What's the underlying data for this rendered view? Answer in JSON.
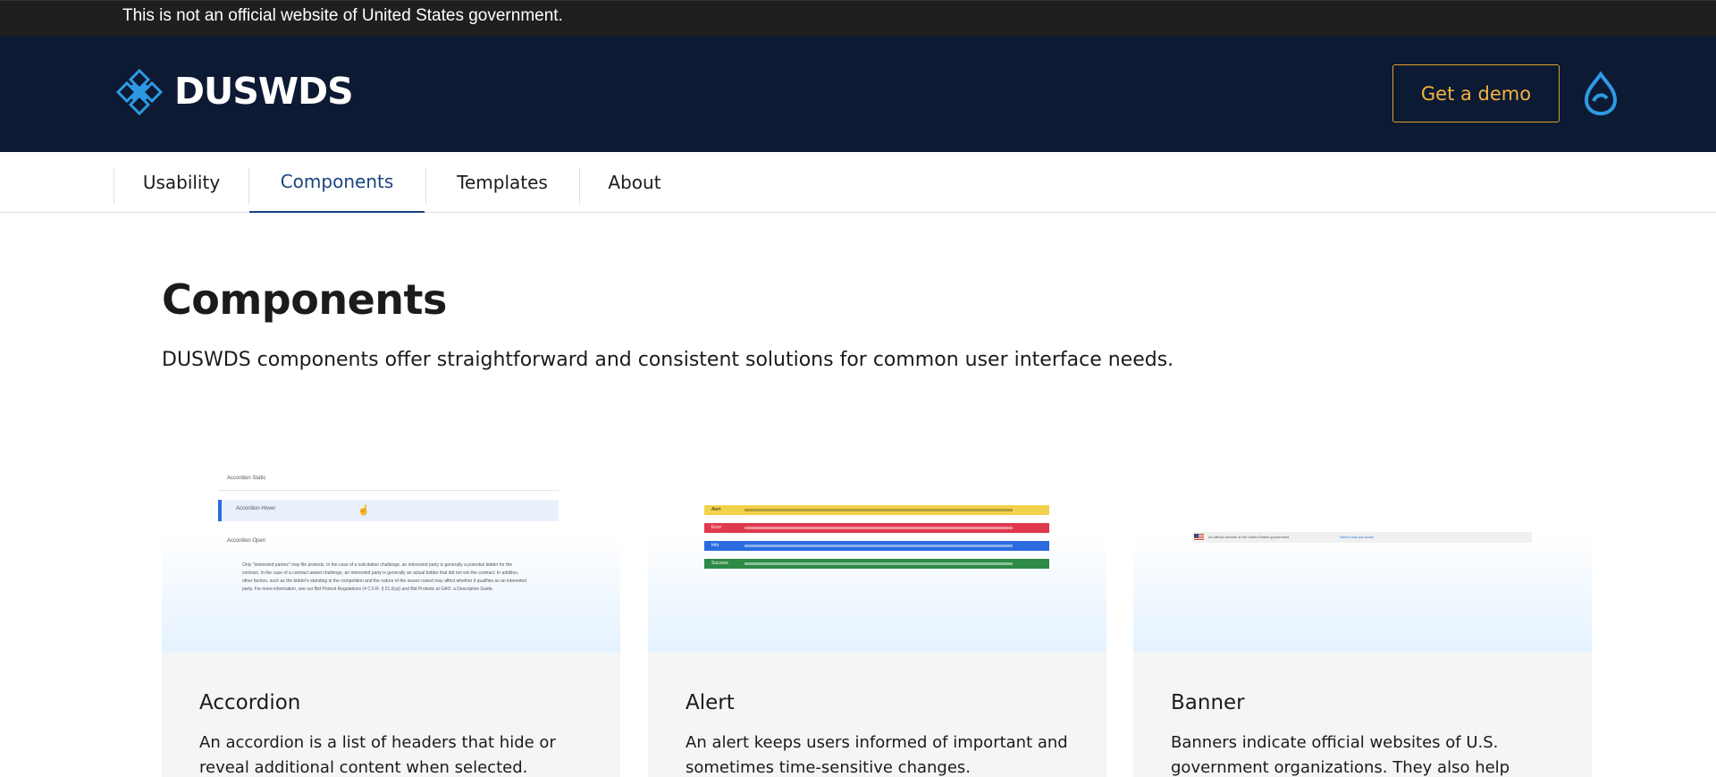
{
  "gov_banner": {
    "text": "This is not an official website of United States government."
  },
  "header": {
    "logo_text": "DUSWDS",
    "demo_button": "Get a demo",
    "logo_icon": "diamond-knot-icon",
    "drupal_icon": "drupal-drop-icon",
    "colors": {
      "background": "#0d1a33",
      "accent": "#f2b33d",
      "icon_blue": "#2e9ae5"
    }
  },
  "nav": {
    "items": [
      {
        "label": "Usability"
      },
      {
        "label": "Components",
        "active": true
      },
      {
        "label": "Templates"
      },
      {
        "label": "About"
      }
    ]
  },
  "main": {
    "title": "Components",
    "intro": "DUSWDS components offer straightforward and consistent solutions for common user interface needs."
  },
  "cards": [
    {
      "title": "Accordion",
      "description": "An accordion is a list of headers that hide or reveal additional content when selected.",
      "preview": {
        "rows": [
          "Accordion Static",
          "Accordion Hover",
          "Accordion Open"
        ],
        "body": "Only \"interested parties\" may file protests. In the case of a solicitation challenge, an interested party is generally a potential bidder for the contract. In the case of a contract award challenge, an interested party is generally an actual bidder that did not win the contract. In addition, other factors, such as the bidder's standing in the competition and the nature of the issues raised may affect whether it qualifies as an interested party. For more information, see our Bid Protest Regulations (4 C.F.R. § 21.0(a)) and Bid Protests at GAO: a Descriptive Guide."
      }
    },
    {
      "title": "Alert",
      "description": "An alert keeps users informed of important and sometimes time-sensitive changes.",
      "preview": {
        "alerts": [
          {
            "label": "Alert",
            "color": "#f2d24a"
          },
          {
            "label": "Error",
            "color": "#e0394d"
          },
          {
            "label": "Info",
            "color": "#2a6be0"
          },
          {
            "label": "Success",
            "color": "#2e8a47"
          }
        ]
      }
    },
    {
      "title": "Banner",
      "description": "Banners indicate official websites of U.S. government organizations. They also help visitors",
      "preview": {
        "banner_text": "An official website of the United States government",
        "banner_link": "Here's how you know"
      }
    }
  ]
}
